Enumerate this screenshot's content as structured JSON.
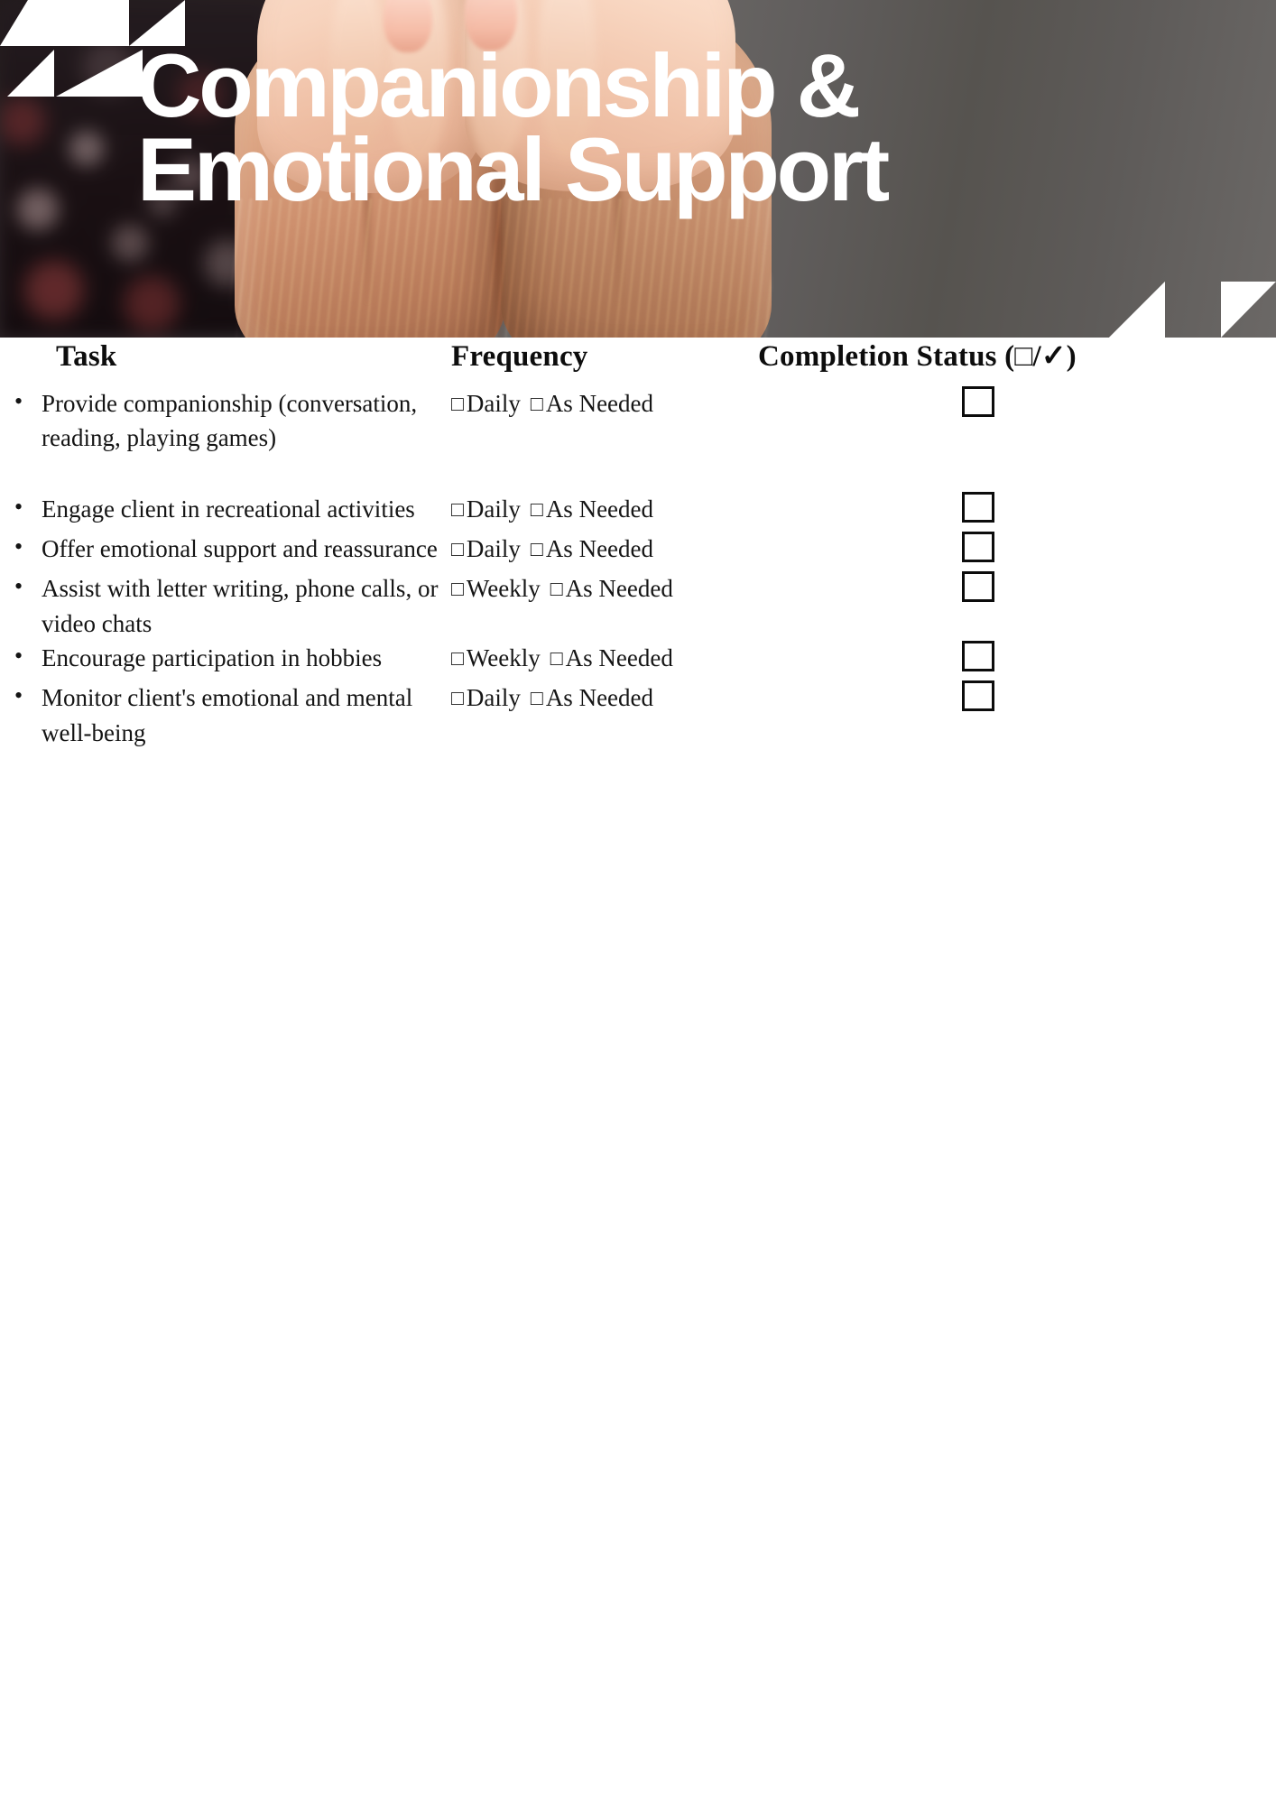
{
  "banner": {
    "title": "Companionship &\nEmotional Support",
    "decor_top_left": "triangle-cluster",
    "decor_bottom_right": "triangle-cluster"
  },
  "table": {
    "columns": [
      {
        "key": "task",
        "label": "Task"
      },
      {
        "key": "frequency",
        "label": "Frequency"
      },
      {
        "key": "status",
        "label": "Completion Status (□/✓)"
      }
    ],
    "checkbox_glyph": "□",
    "rows": [
      {
        "task": "Provide companionship (conversation, reading, playing games)",
        "frequency_options": [
          "Daily",
          "As Needed"
        ],
        "status_checked": false
      },
      {
        "task": "Engage client in recreational activities",
        "frequency_options": [
          "Daily",
          "As Needed"
        ],
        "status_checked": false
      },
      {
        "task": "Offer emotional support and reassurance",
        "frequency_options": [
          "Daily",
          "As Needed"
        ],
        "status_checked": false
      },
      {
        "task": "Assist with letter writing, phone calls, or video chats",
        "frequency_options": [
          "Weekly",
          "As Needed"
        ],
        "status_checked": false
      },
      {
        "task": "Encourage participation in hobbies",
        "frequency_options": [
          "Weekly",
          "As Needed"
        ],
        "status_checked": false
      },
      {
        "task": "Monitor client's emotional and mental well-being",
        "frequency_options": [
          "Daily",
          "As Needed"
        ],
        "status_checked": false
      }
    ]
  },
  "colors": {
    "page_background": "#ffffff",
    "text": "#141414",
    "banner_overlay_text": "#ffffff",
    "decor_shape": "#ffffff",
    "checkbox_border": "#0c0c0c"
  }
}
